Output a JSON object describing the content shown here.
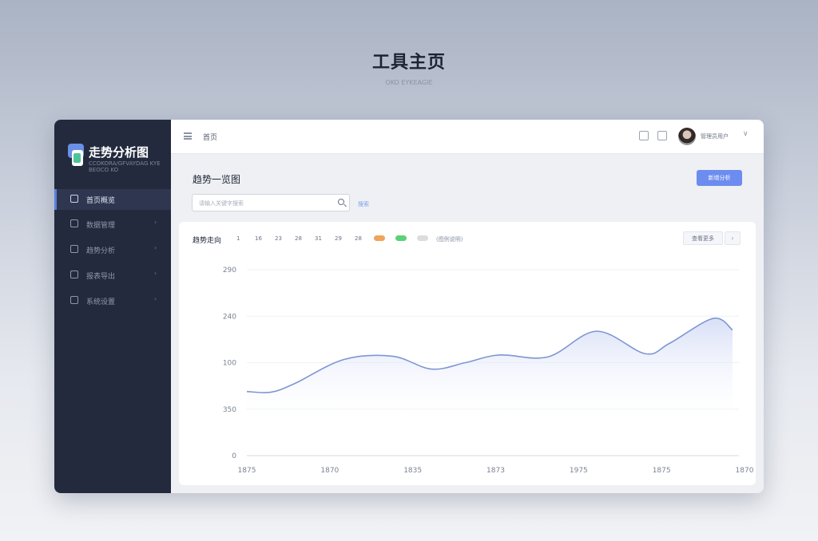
{
  "page": {
    "title": "工具主页",
    "subtitle": "OKO EYKEAGIE"
  },
  "sidebar": {
    "brand": {
      "name": "走势分析图",
      "tagline": "CCOKORA/GFVAYDAG KYE BEOCO KO"
    },
    "items": [
      {
        "label": "首页概览",
        "icon": "home-icon",
        "active": true
      },
      {
        "label": "数据管理",
        "icon": "database-icon",
        "chevron": "›"
      },
      {
        "label": "趋势分析",
        "icon": "chart-icon",
        "chevron": "›"
      },
      {
        "label": "报表导出",
        "icon": "report-icon",
        "chevron": "›"
      },
      {
        "label": "系统设置",
        "icon": "settings-icon",
        "chevron": "›"
      }
    ]
  },
  "topbar": {
    "breadcrumb": "首页",
    "icons": [
      "message-icon",
      "bell-icon"
    ],
    "user_name": "管理员用户",
    "chevron": "∨"
  },
  "content": {
    "section_title": "趋势一览图",
    "primary_button": "新增分析",
    "search": {
      "placeholder": "请输入关键字搜索",
      "link": "搜索"
    }
  },
  "chart_card": {
    "title": "趋势走向",
    "range_options": [
      "1",
      "16",
      "23",
      "28",
      "31",
      "29",
      "28"
    ],
    "legend": [
      {
        "name": "",
        "color": "#f0a35b"
      },
      {
        "name": "",
        "color": "#5ad277"
      },
      {
        "name": "(图例说明)",
        "color": "#dddddd"
      }
    ],
    "more_button": "查看更多",
    "next_icon": "chevron-right-icon",
    "next_label": "›"
  },
  "chart_data": {
    "type": "area",
    "title": "",
    "xlabel": "",
    "ylabel": "",
    "x_ticks": [
      "1875",
      "1870",
      "1835",
      "1873",
      "1975",
      "1875",
      "1870"
    ],
    "y_ticks": [
      "0",
      "350",
      "100",
      "240",
      "290"
    ],
    "ylim": [
      0,
      290
    ],
    "grid": true,
    "line_color": "#7e96d2",
    "fill_color": "#dfe5f8",
    "series": [
      {
        "name": "",
        "x": [
          0,
          0.05,
          0.1,
          0.2,
          0.3,
          0.38,
          0.45,
          0.52,
          0.62,
          0.72,
          0.82,
          0.87,
          0.96,
          1.0
        ],
        "values": [
          100,
          99,
          113,
          150,
          155,
          135,
          145,
          157,
          154,
          194,
          159,
          175,
          214,
          196
        ]
      }
    ]
  }
}
